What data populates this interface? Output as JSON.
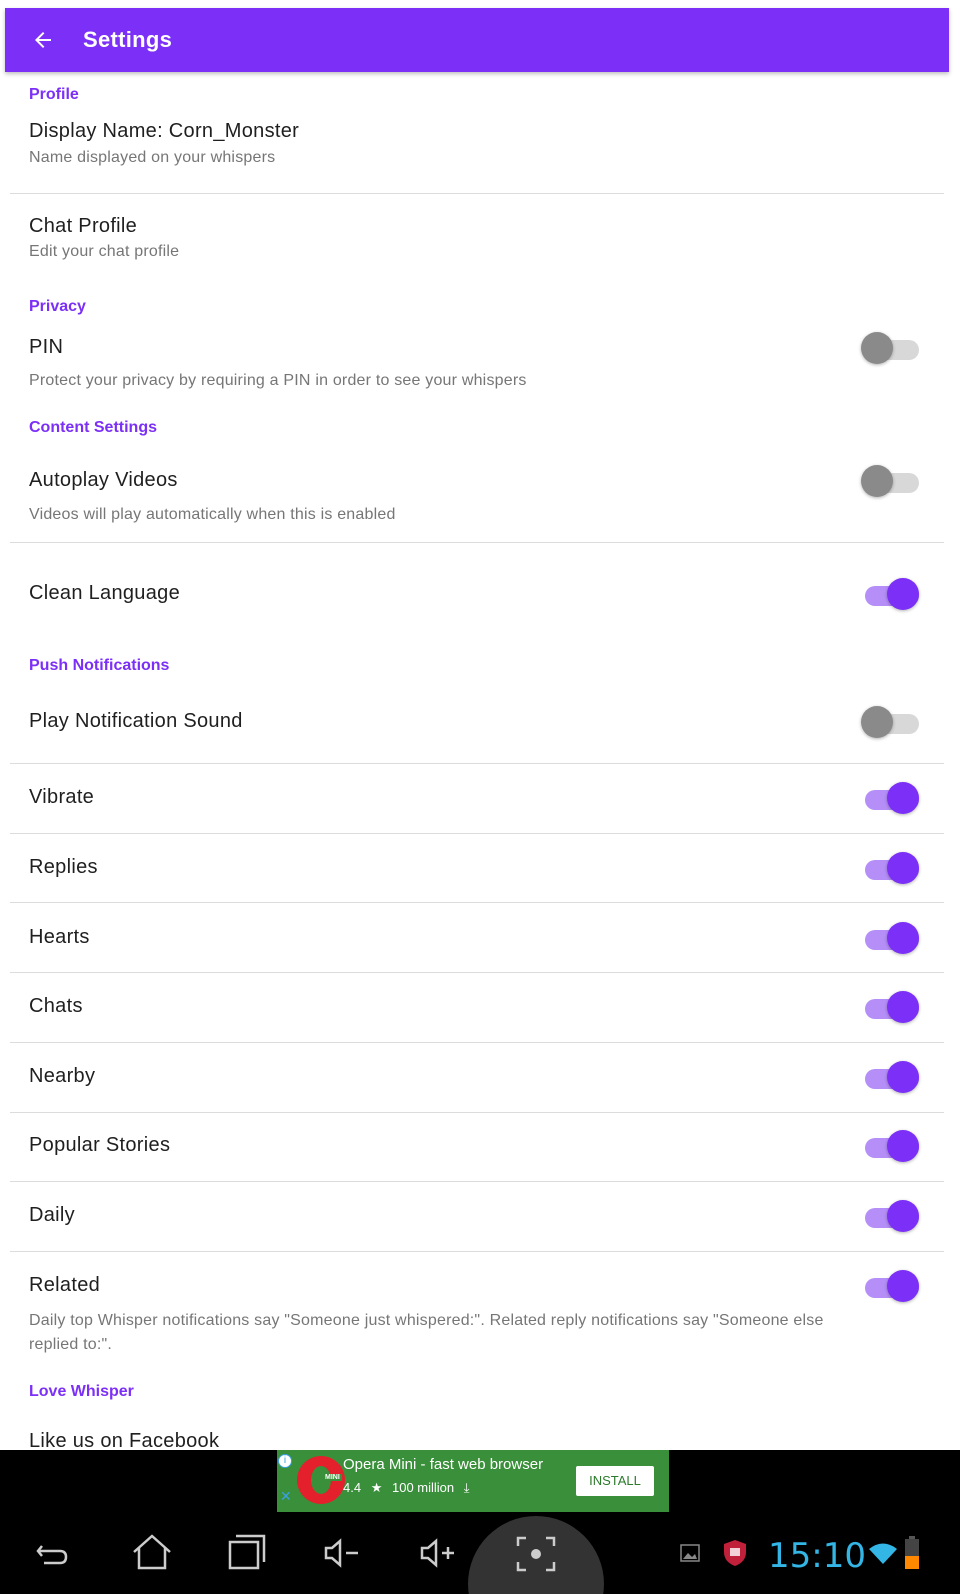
{
  "app_bar": {
    "title": "Settings",
    "back_icon": "arrow-left-icon"
  },
  "sections": {
    "profile": "Profile",
    "privacy": "Privacy",
    "content_settings": "Content Settings",
    "push_notifications": "Push Notifications",
    "love_whisper": "Love Whisper"
  },
  "rows": {
    "display_name": {
      "title": "Display Name: Corn_Monster",
      "subtitle": "Name displayed on your whispers"
    },
    "chat_profile": {
      "title": "Chat Profile",
      "subtitle": "Edit your chat profile"
    },
    "pin": {
      "title": "PIN",
      "subtitle": "Protect your privacy by requiring a PIN in order to see your whispers",
      "enabled": false
    },
    "autoplay_videos": {
      "title": "Autoplay Videos",
      "subtitle": "Videos will play automatically when this is enabled",
      "enabled": false
    },
    "clean_language": {
      "title": "Clean Language",
      "enabled": true
    },
    "play_notification_sound": {
      "title": "Play Notification Sound",
      "enabled": false
    },
    "vibrate": {
      "title": "Vibrate",
      "enabled": true
    },
    "replies": {
      "title": "Replies",
      "enabled": true
    },
    "hearts": {
      "title": "Hearts",
      "enabled": true
    },
    "chats": {
      "title": "Chats",
      "enabled": true
    },
    "nearby": {
      "title": "Nearby",
      "enabled": true
    },
    "popular_stories": {
      "title": "Popular Stories",
      "enabled": true
    },
    "daily": {
      "title": "Daily",
      "enabled": true
    },
    "related": {
      "title": "Related",
      "enabled": true,
      "subtitle_line1": "Daily top Whisper notifications say \"Someone just whispered:\". Related reply notifications say \"Someone else",
      "subtitle_line2": "replied to:\"."
    },
    "like_facebook": {
      "title": "Like us on Facebook"
    }
  },
  "ad": {
    "app_name": "Opera Mini - fast web browser",
    "rating": "4.4",
    "installs": "100 million",
    "install_label": "INSTALL",
    "logo_text": "MINI"
  },
  "status_bar": {
    "time": "15:10"
  },
  "colors": {
    "accent": "#7b2ff7",
    "toggle_on_track": "#b58ff7",
    "toggle_off_thumb": "#8a8a8a",
    "ad_bg": "#3a8f3a",
    "clock": "#33b5e5"
  }
}
